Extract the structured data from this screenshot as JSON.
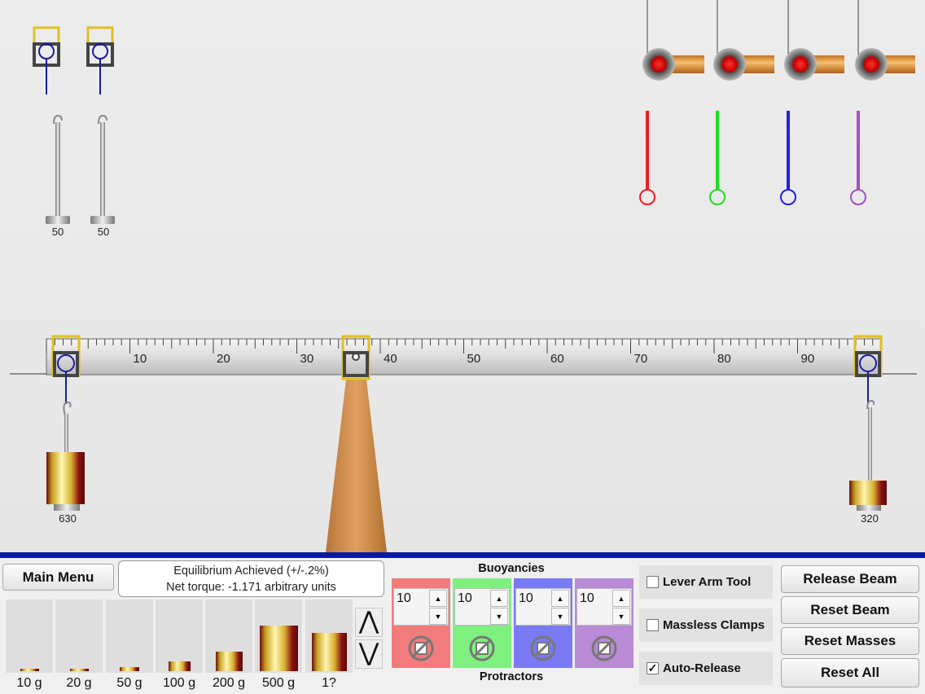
{
  "beam": {
    "tick_labels": [
      "10",
      "20",
      "30",
      "40",
      "50",
      "60",
      "70",
      "80",
      "90"
    ]
  },
  "spare_weights": [
    {
      "label": "50"
    },
    {
      "label": "50"
    }
  ],
  "hanging_masses": {
    "left": {
      "label": "630"
    },
    "right": {
      "label": "320"
    }
  },
  "colors": {
    "red": "#ee1c24",
    "green": "#22dd22",
    "blue": "#2222dd",
    "purple": "#a050c0",
    "divider": "#0a1a9e"
  },
  "buttons": {
    "main_menu": "Main Menu",
    "release_beam": "Release Beam",
    "reset_beam": "Reset Beam",
    "reset_masses": "Reset Masses",
    "reset_all": "Reset All"
  },
  "status": {
    "line1": "Equilibrium Achieved  (+/-.2%)",
    "line2": "Net torque: -1.171  arbitrary units"
  },
  "mass_tray": [
    {
      "label": "10 g",
      "fill": 0.02
    },
    {
      "label": "20 g",
      "fill": 0.03
    },
    {
      "label": "50 g",
      "fill": 0.06
    },
    {
      "label": "100 g",
      "fill": 0.13
    },
    {
      "label": "200 g",
      "fill": 0.27
    },
    {
      "label": "500 g",
      "fill": 0.62
    },
    {
      "label": "1?",
      "fill": 0.52
    }
  ],
  "tray_arrows": {
    "up": "⋀",
    "down": "⋁"
  },
  "buoyancies": {
    "title": "Buoyancies",
    "footer": "Protractors",
    "columns": [
      {
        "value": "10",
        "color": "#f27c7c"
      },
      {
        "value": "10",
        "color": "#7ff07f"
      },
      {
        "value": "10",
        "color": "#7a7af5"
      },
      {
        "value": "10",
        "color": "#b98ad6"
      }
    ]
  },
  "checkboxes": [
    {
      "label": "Lever Arm Tool",
      "checked": false
    },
    {
      "label": "Massless Clamps",
      "checked": false
    },
    {
      "label": "Auto-Release",
      "checked": true
    }
  ]
}
